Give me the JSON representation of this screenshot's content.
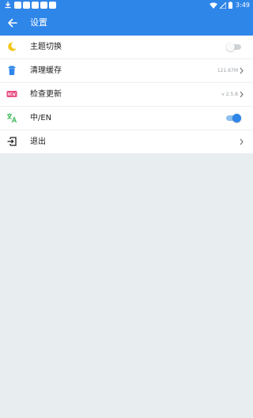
{
  "statusbar": {
    "time": "3:49",
    "notification_boxes": 5
  },
  "appbar": {
    "title": "设置",
    "back_icon": "arrow-left-icon"
  },
  "settings": [
    {
      "id": "theme",
      "label": "主题切换",
      "icon": "moon-icon",
      "control": "toggle",
      "toggle_on": false
    },
    {
      "id": "cache",
      "label": "清理缓存",
      "icon": "trash-icon",
      "value": "121.67M",
      "control": "chevron"
    },
    {
      "id": "update",
      "label": "检查更新",
      "icon": "new-badge-icon",
      "value": "v 2.5.8",
      "control": "chevron"
    },
    {
      "id": "language",
      "label": "中/EN",
      "icon": "translate-icon",
      "control": "toggle",
      "toggle_on": true
    },
    {
      "id": "logout",
      "label": "退出",
      "icon": "exit-icon",
      "control": "chevron"
    }
  ],
  "colors": {
    "primary": "#2f86e9",
    "background": "#e8edf0",
    "moon": "#f5c518",
    "trash": "#2f86e9",
    "new_badge": "#e84a7f",
    "translate": "#2fb34a"
  }
}
